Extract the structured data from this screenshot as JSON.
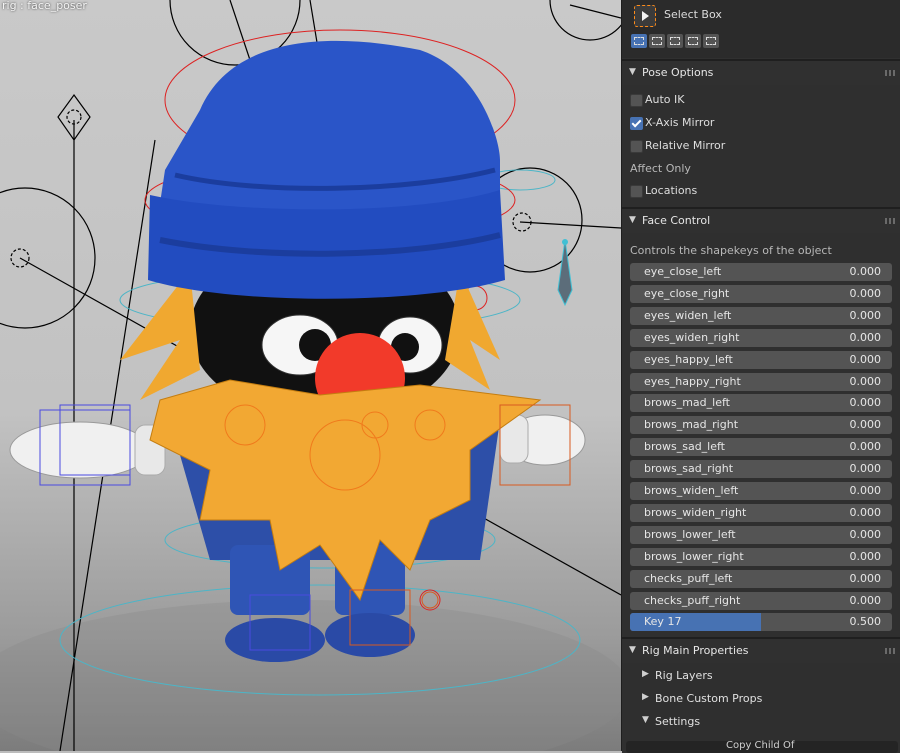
{
  "viewport": {
    "label": "rig : face_poser"
  },
  "toolbar": {
    "tool_label": "Select Box",
    "mode_icons": [
      "set-selection-icon",
      "extend-selection-icon",
      "subtract-selection-icon",
      "invert-selection-icon",
      "intersect-selection-icon"
    ]
  },
  "pose_options": {
    "title": "Pose Options",
    "auto_ik": {
      "label": "Auto IK",
      "checked": false
    },
    "x_axis_mirror": {
      "label": "X-Axis Mirror",
      "checked": true
    },
    "relative_mirror": {
      "label": "Relative Mirror",
      "checked": false
    },
    "affect_only": "Affect Only",
    "locations": {
      "label": "Locations",
      "checked": false
    }
  },
  "face_control": {
    "title": "Face Control",
    "description": "Controls the shapekeys of the object",
    "keys": [
      {
        "name": "eye_close_left",
        "value": "0.000"
      },
      {
        "name": "eye_close_right",
        "value": "0.000"
      },
      {
        "name": "eyes_widen_left",
        "value": "0.000"
      },
      {
        "name": "eyes_widen_right",
        "value": "0.000"
      },
      {
        "name": "eyes_happy_left",
        "value": "0.000"
      },
      {
        "name": "eyes_happy_right",
        "value": "0.000"
      },
      {
        "name": "brows_mad_left",
        "value": "0.000"
      },
      {
        "name": "brows_mad_right",
        "value": "0.000"
      },
      {
        "name": "brows_sad_left",
        "value": "0.000"
      },
      {
        "name": "brows_sad_right",
        "value": "0.000"
      },
      {
        "name": "brows_widen_left",
        "value": "0.000"
      },
      {
        "name": "brows_widen_right",
        "value": "0.000"
      },
      {
        "name": "brows_lower_left",
        "value": "0.000"
      },
      {
        "name": "brows_lower_right",
        "value": "0.000"
      },
      {
        "name": "checks_puff_left",
        "value": "0.000"
      },
      {
        "name": "checks_puff_right",
        "value": "0.000"
      },
      {
        "name": "Key 17",
        "value": "0.500",
        "fraction": 0.5
      }
    ]
  },
  "rig_main": {
    "title": "Rig Main Properties",
    "items": [
      {
        "label": "Rig Layers",
        "expanded": false
      },
      {
        "label": "Bone Custom Props",
        "expanded": false
      },
      {
        "label": "Settings",
        "expanded": true
      }
    ],
    "bottom_label": "Copy Child Of"
  },
  "colors": {
    "accent": "#4772b3",
    "active_tool_outline": "#ff8c1a",
    "hat": "#2a55c8",
    "beard": "#f2a833",
    "nose": "#f23a2a"
  }
}
